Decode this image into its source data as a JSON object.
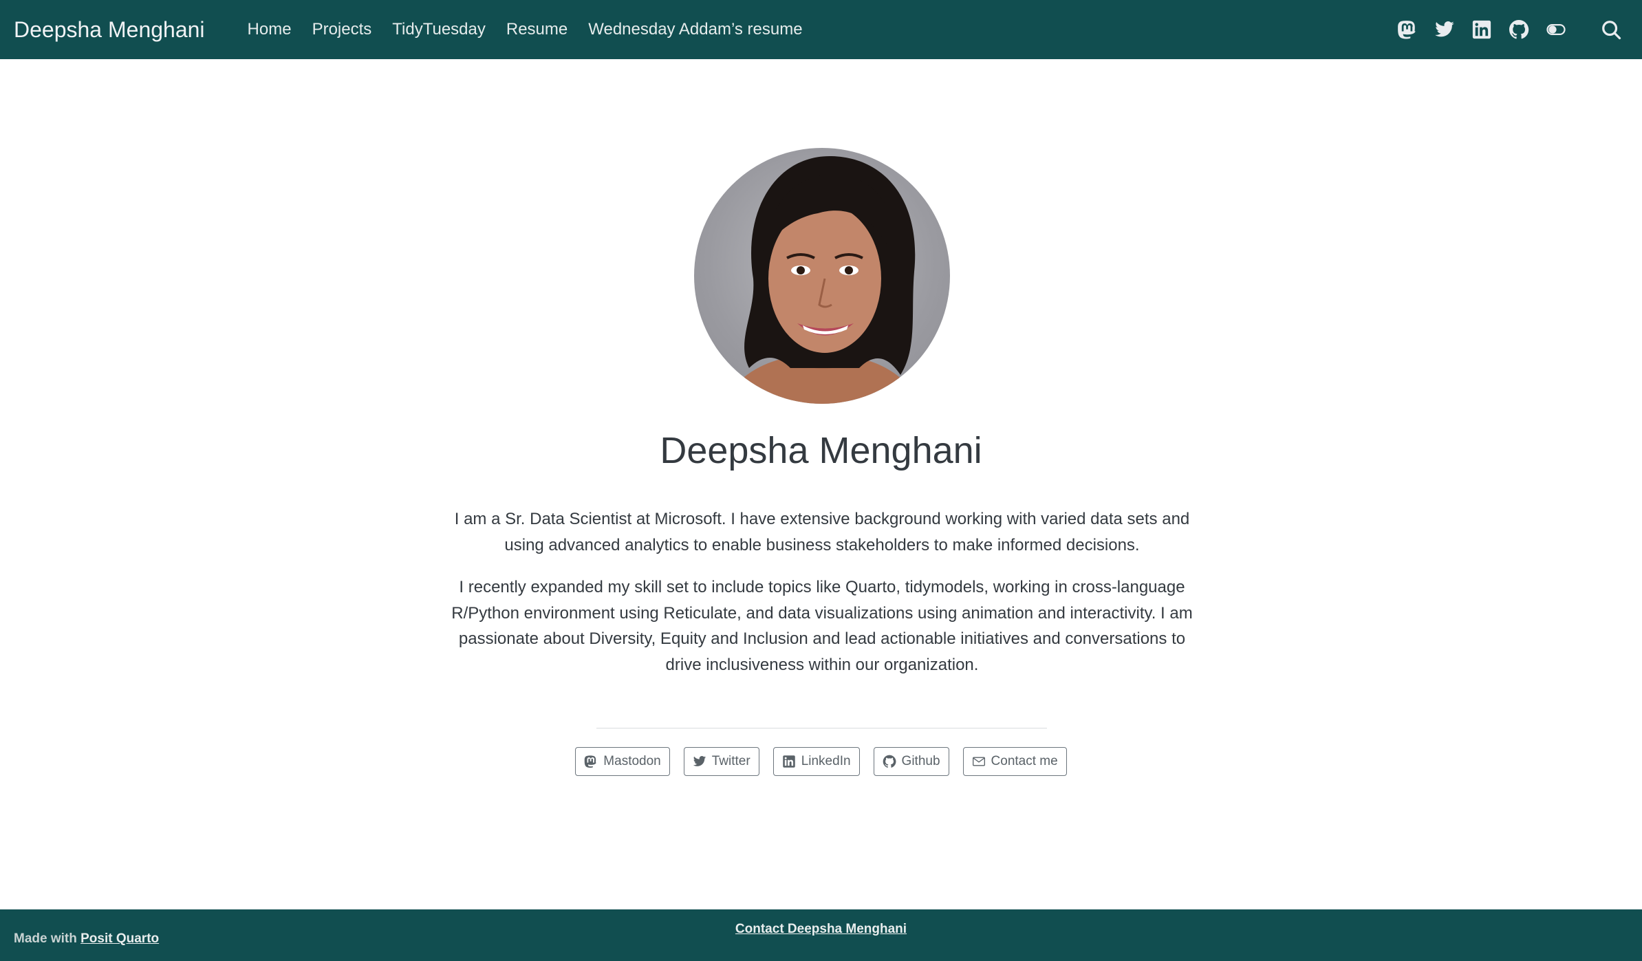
{
  "navbar": {
    "brand": "Deepsha Menghani",
    "links": [
      "Home",
      "Projects",
      "TidyTuesday",
      "Resume",
      "Wednesday Addam’s resume"
    ],
    "icons": [
      "mastodon-icon",
      "twitter-icon",
      "linkedin-icon",
      "github-icon",
      "dark-mode-toggle-icon",
      "search-icon"
    ]
  },
  "profile": {
    "name": "Deepsha Menghani",
    "bio": [
      "I am a Sr. Data Scientist at Microsoft. I have extensive background working with varied data sets and using advanced analytics to enable business stakeholders to make informed decisions.",
      "I recently expanded my skill set to include topics like Quarto, tidymodels, working in cross-language R/Python environment using Reticulate, and data visualizations using animation and interactivity. I am passionate about Diversity, Equity and Inclusion and lead actionable initiatives and conversations to drive inclusiveness within our organization."
    ]
  },
  "about_links": [
    {
      "label": "Mastodon",
      "icon": "mastodon-icon"
    },
    {
      "label": "Twitter",
      "icon": "twitter-icon"
    },
    {
      "label": "LinkedIn",
      "icon": "linkedin-icon"
    },
    {
      "label": "Github",
      "icon": "github-icon"
    },
    {
      "label": "Contact me",
      "icon": "envelope-icon"
    }
  ],
  "footer": {
    "made_with": "Made with",
    "made_with_link": "Posit Quarto",
    "contact": "Contact Deepsha Menghani"
  },
  "colors": {
    "navbar_bg": "#114e50",
    "text": "#343a40",
    "button_border": "#6c757d"
  }
}
